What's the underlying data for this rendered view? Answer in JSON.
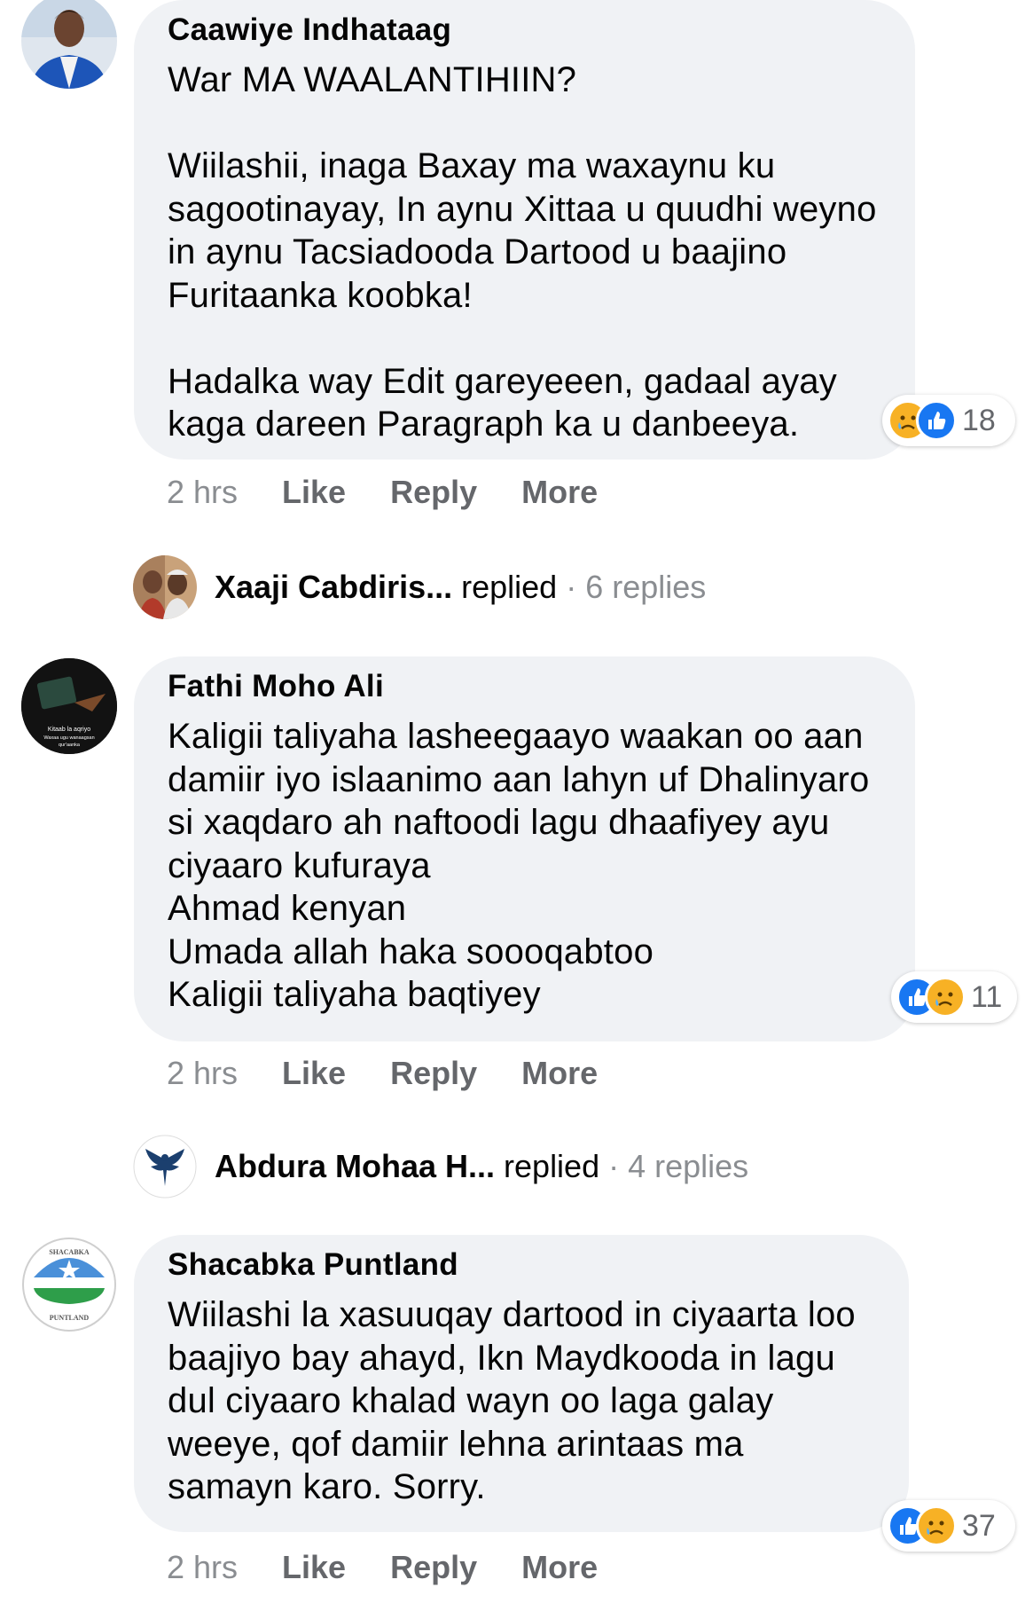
{
  "comments": [
    {
      "author": "Caawiye Indhataag",
      "text": "War MA WAALANTIHIIN?\n\nWiilashii, inaga Baxay ma waxaynu ku sagootinayay, In aynu Xittaa u quudhi weyno in aynu Tacsiadooda Dartood u baajino Furitaanka koobka!\n\nHadalka way Edit gareyeeen, gadaal ayay kaga dareen Paragraph ka u danbeeya.",
      "time": "2 hrs",
      "like": "Like",
      "reply": "Reply",
      "more": "More",
      "reaction_count": "18",
      "reaction_icons": [
        "sad-icon",
        "like-icon"
      ]
    },
    {
      "author": "Fathi Moho Ali",
      "text": "Kaligii taliyaha lasheegaayo waakan oo aan damiir iyo islaanimo aan lahyn uf Dhalinyaro si xaqdaro ah naftoodi lagu dhaafiyey ayu ciyaaro kufuraya\nAhmad kenyan\nUmada allah haka soooqabtoo\nKaligii taliyaha baqtiyey",
      "time": "2 hrs",
      "like": "Like",
      "reply": "Reply",
      "more": "More",
      "reaction_count": "11",
      "reaction_icons": [
        "like-icon",
        "sad-icon"
      ],
      "avatar_text": [
        "Kitaab la aqriyo",
        "Waxaa ugu wanaagsan",
        "qur'aanka"
      ]
    },
    {
      "author": "Shacabka Puntland",
      "text": "Wiilashi la xasuuqay dartood in ciyaarta loo baajiyo bay ahayd, Ikn Maydkooda in lagu dul ciyaaro khalad wayn oo laga galay weeye, qof damiir lehna arintaas ma samayn karo. Sorry.",
      "time": "2 hrs",
      "like": "Like",
      "reply": "Reply",
      "more": "More",
      "reaction_count": "37",
      "reaction_icons": [
        "like-icon",
        "sad-icon"
      ],
      "avatar_text": [
        "SHACABKA",
        "PUNTLAND"
      ]
    }
  ],
  "replies": [
    {
      "name": "Xaaji Cabdiris...",
      "verb": "replied",
      "sep": "·",
      "count": "6 replies"
    },
    {
      "name": "Abdura Mohaa H...",
      "verb": "replied",
      "sep": "·",
      "count": "4 replies"
    }
  ],
  "colors": {
    "bubble": "#f0f2f5",
    "like_blue": "#1877f2",
    "sad_yellow": "#f7b125",
    "meta_gray": "#65676b"
  }
}
